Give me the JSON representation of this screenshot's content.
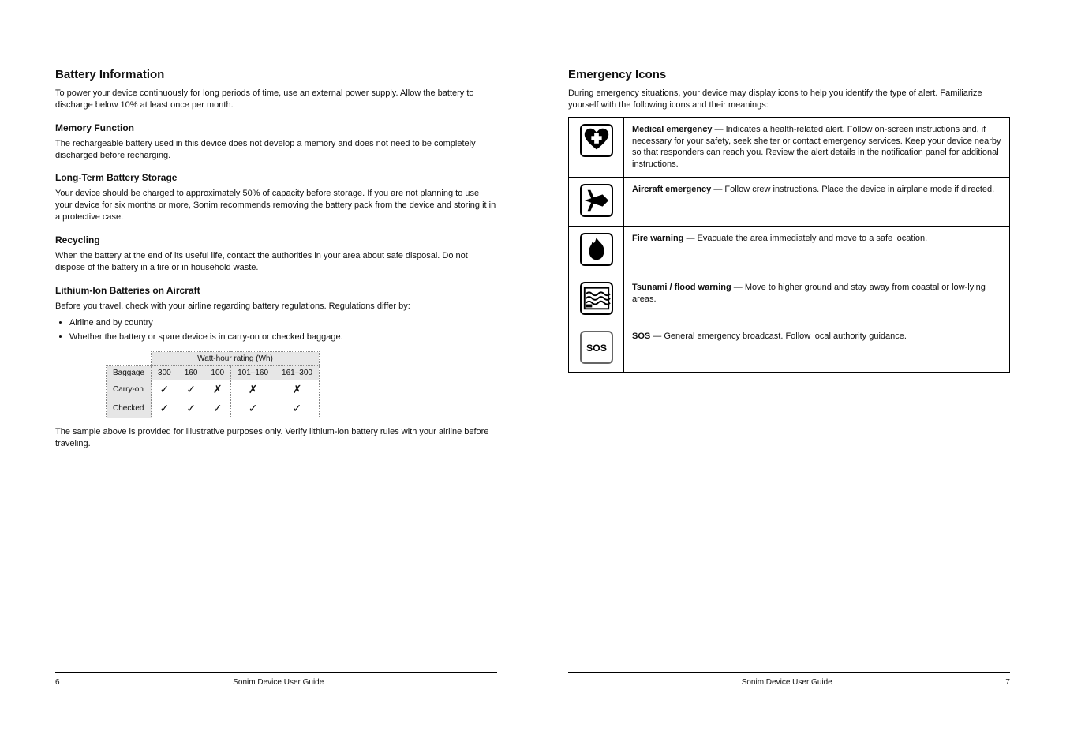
{
  "left": {
    "h1": "Battery Information",
    "p0": "To power your device continuously for long periods of time, use an external power supply. Allow the battery to discharge below 10% at least once per month.",
    "h2a": "Memory Function",
    "p1": "The rechargeable battery used in this device does not develop a memory and does not need to be completely discharged before recharging.",
    "h2b": "Long-Term Battery Storage",
    "p2": "Your device should be charged to approximately 50% of capacity before storage. If you are not planning to use your device for six months or more, Sonim recommends removing the battery pack from the device and storing it in a protective case.",
    "h2c": "Recycling",
    "p3": "When the battery at the end of its useful life, contact the authorities in your area about safe disposal. Do not dispose of the battery in a fire or in household waste.",
    "h2d": "Lithium-Ion Batteries on Aircraft",
    "p4": "Before you travel, check with your airline regarding battery regulations. Regulations differ by:",
    "li0": "Airline and by country",
    "li1": "Whether the battery or spare device is in carry-on or checked baggage.",
    "table_labels": {
      "baggage": "Baggage",
      "cols": [
        "300",
        "160",
        "100",
        "101–160",
        "161–300"
      ],
      "row0": "Carry-on",
      "row1": "Checked"
    },
    "table": {
      "carry": [
        "✓",
        "✓",
        "✗",
        "✗",
        "✗"
      ],
      "checked": [
        "✓",
        "✓",
        "✓",
        "✓",
        "✓"
      ]
    },
    "p5": "The sample above is provided for illustrative purposes only. Verify lithium-ion battery rules with your airline before traveling."
  },
  "right": {
    "h1": "Emergency Icons",
    "p0": "During emergency situations, your device may display icons to help you identify the type of alert. Familiarize yourself with the following icons and their meanings:",
    "rows": [
      {
        "icon": "heart",
        "title": "Medical emergency",
        "body": "Indicates a health-related alert. Follow on-screen instructions and, if necessary for your safety, seek shelter or contact emergency services. Keep your device nearby so that responders can reach you. Review the alert details in the notification panel for additional instructions."
      },
      {
        "icon": "plane",
        "title": "Aircraft emergency",
        "body": "Follow crew instructions. Place the device in airplane mode if directed."
      },
      {
        "icon": "fire",
        "title": "Fire warning",
        "body": "Evacuate the area immediately and move to a safe location."
      },
      {
        "icon": "waves",
        "title": "Tsunami / flood warning",
        "body": "Move to higher ground and stay away from coastal or low-lying areas."
      },
      {
        "icon": "sos",
        "title": "SOS",
        "body": "General emergency broadcast. Follow local authority guidance."
      }
    ]
  },
  "footer": {
    "left_num": "6",
    "center": "Sonim Device User Guide",
    "right_num": "7"
  }
}
